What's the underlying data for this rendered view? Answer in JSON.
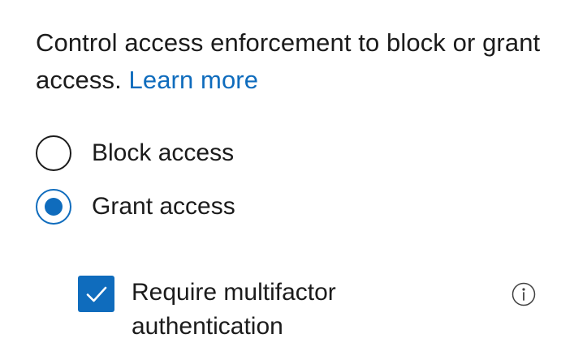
{
  "description": {
    "text": "Control access enforcement to block or grant access.",
    "link_label": "Learn more"
  },
  "access_options": [
    {
      "label": "Block access",
      "selected": false
    },
    {
      "label": "Grant access",
      "selected": true
    }
  ],
  "grant_controls": {
    "require_mfa_label": "Require multifactor authentication",
    "require_mfa_checked": true,
    "info_icon": "info-icon"
  },
  "colors": {
    "accent": "#0f6cbd",
    "text": "#1b1b1b",
    "background": "#ffffff"
  }
}
